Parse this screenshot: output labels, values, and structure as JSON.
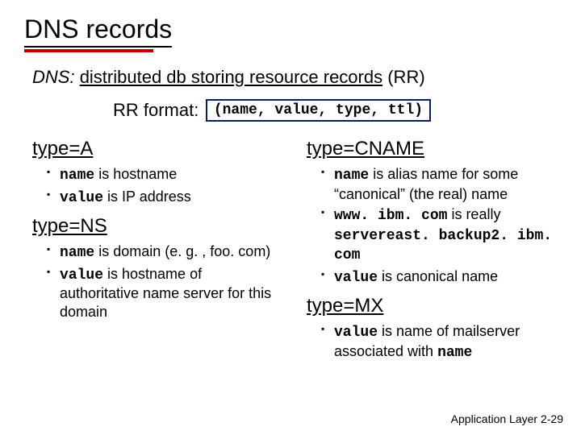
{
  "title": "DNS records",
  "intro": {
    "dns": "DNS:",
    "mid": "distributed db storing resource records",
    "rr": "(RR)"
  },
  "rr": {
    "label": "RR format:",
    "box": "(name, value, type, ttl)"
  },
  "left": {
    "a": {
      "head": "type=A",
      "b1_code": "name",
      "b1_rest": " is hostname",
      "b2_code": "value",
      "b2_rest": " is IP address"
    },
    "ns": {
      "head": "type=NS",
      "b1_code": "name",
      "b1_rest": " is domain (e. g. , foo. com)",
      "b2_code": "value",
      "b2_rest": " is hostname of authoritative name server for this domain"
    }
  },
  "right": {
    "cname": {
      "head": "type=CNAME",
      "b1_code": "name",
      "b1_rest": " is alias name for some “canonical” (the real) name",
      "b2_code1": "www. ibm. com",
      "b2_mid": " is really ",
      "b2_code2": "servereast. backup2. ibm. com",
      "b3_code": "value",
      "b3_rest": " is canonical name"
    },
    "mx": {
      "head": "type=MX",
      "b1_code": "value",
      "b1_mid": " is name of mailserver associated with ",
      "b1_code2": "name"
    }
  },
  "footer": {
    "left": "Application Layer",
    "right": " 2-29"
  }
}
